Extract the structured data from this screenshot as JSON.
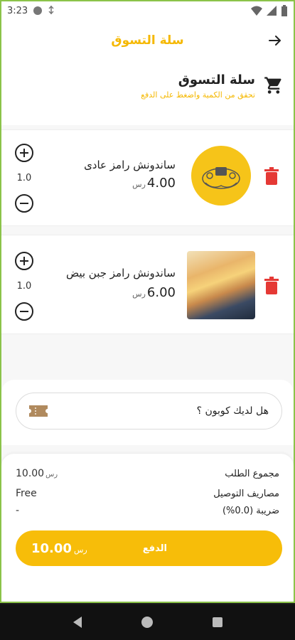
{
  "status_bar": {
    "time": "3:23"
  },
  "app_bar": {
    "title": "سلة التسوق"
  },
  "cart_header": {
    "title": "سلة التسوق",
    "subtitle": "تحقق من الكمية واضغط على الدفع"
  },
  "items": [
    {
      "name": "ساندونش رامز عادى",
      "price": "4.00",
      "currency": "رس",
      "quantity": "1.0"
    },
    {
      "name": "ساندونش رامز جبن بيض",
      "price": "6.00",
      "currency": "رس",
      "quantity": "1.0"
    }
  ],
  "coupon": {
    "placeholder": "هل لديك كوبون ؟"
  },
  "summary": {
    "order_total_label": "مجموع الطلب",
    "order_total_value": "10.00",
    "order_total_currency": "رس",
    "delivery_label": "مصاريف التوصيل",
    "delivery_value": "Free",
    "tax_label": "ضريبة (0.0%)",
    "tax_value": "-"
  },
  "pay_button": {
    "label": "الدفع",
    "total": "10.00",
    "currency": "رس"
  },
  "colors": {
    "accent": "#f7bd09",
    "delete": "#e53935",
    "frame": "#8bc34a"
  },
  "icons": [
    "back-arrow-icon",
    "cart-icon",
    "trash-icon",
    "plus-icon",
    "minus-icon",
    "coupon-ticket-icon",
    "nav-back-icon",
    "nav-home-icon",
    "nav-recents-icon"
  ]
}
